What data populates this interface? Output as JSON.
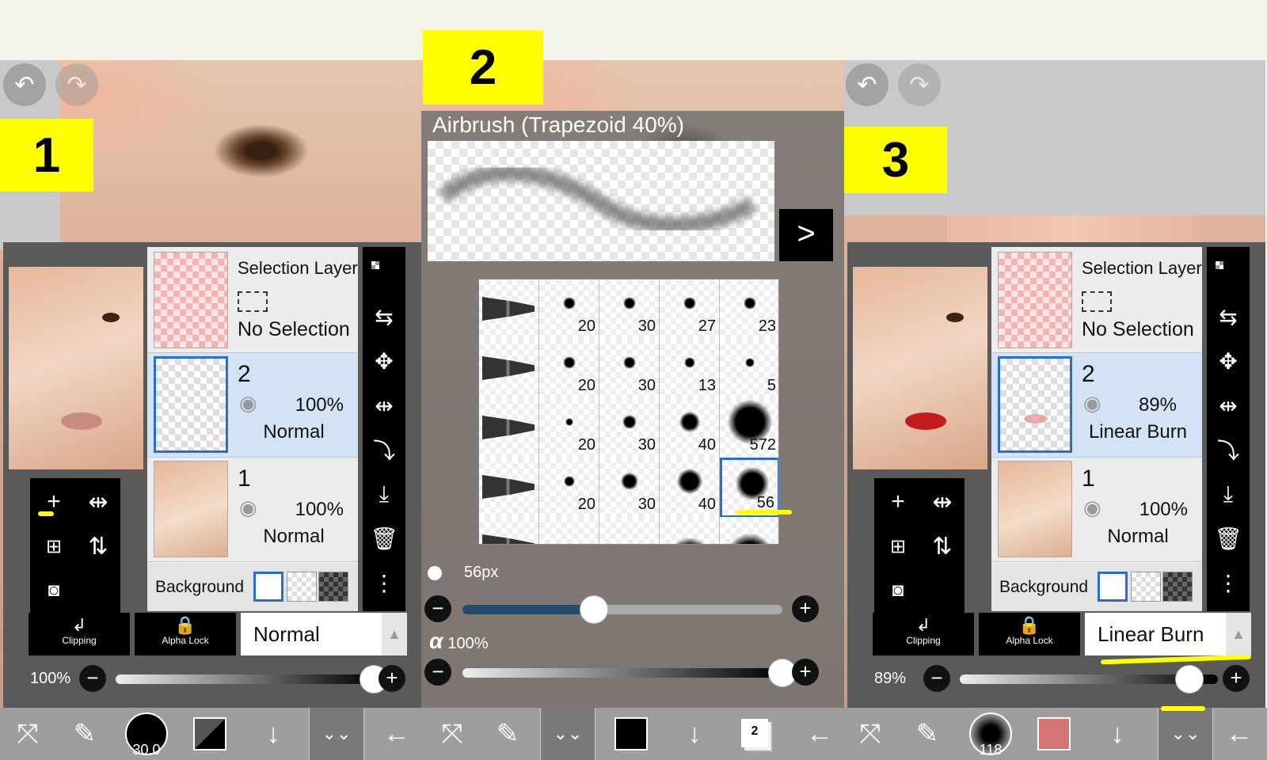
{
  "tags": {
    "p1": "1",
    "p2": "2",
    "p3": "3"
  },
  "icons": {
    "undo": "↶",
    "redo": "↷",
    "plus": "+",
    "camera": "📷",
    "next": ">",
    "eye": "◉"
  },
  "panel1": {
    "layers": {
      "selection": {
        "title": "Selection Layer",
        "status": "No Selection"
      },
      "layer2": {
        "name": "2",
        "opacity": "100%",
        "mode": "Normal"
      },
      "layer1": {
        "name": "1",
        "opacity": "100%",
        "mode": "Normal"
      },
      "background_label": "Background"
    },
    "clipping_label": "Clipping",
    "alpha_lock_label": "Alpha Lock",
    "blend_mode": "Normal",
    "opacity_label": "100%",
    "opacity_value": 1.0
  },
  "panel2": {
    "brush_name": "Airbrush (Trapezoid 40%)",
    "brush_rows": [
      [
        "20",
        "30",
        "27",
        "23"
      ],
      [
        "20",
        "30",
        "13",
        "5"
      ],
      [
        "20",
        "30",
        "40",
        "572"
      ],
      [
        "20",
        "30",
        "40",
        "56"
      ],
      [
        "",
        "",
        "",
        ""
      ]
    ],
    "selected_brush": {
      "row": 3,
      "col": 3
    },
    "size_label": "56px",
    "size_value_fraction": 0.41,
    "alpha_symbol": "α",
    "alpha_label": "100%",
    "alpha_fraction": 1.0
  },
  "panel3": {
    "layers": {
      "selection": {
        "title": "Selection Layer",
        "status": "No Selection"
      },
      "layer2": {
        "name": "2",
        "opacity": "89%",
        "mode": "Linear Burn"
      },
      "layer1": {
        "name": "1",
        "opacity": "100%",
        "mode": "Normal"
      },
      "background_label": "Background"
    },
    "clipping_label": "Clipping",
    "alpha_lock_label": "Alpha Lock",
    "blend_mode": "Linear Burn",
    "opacity_label": "89%",
    "opacity_value": 0.89
  },
  "toolbar": {
    "brush_size_1": "30.0",
    "brush_size_2": "118",
    "layer_count": "2",
    "color_1": "#000000",
    "color_2": "#000000",
    "color_3": "#d47474"
  },
  "colors": {
    "highlight": "#ffff00",
    "accent": "#2a6dd2"
  }
}
